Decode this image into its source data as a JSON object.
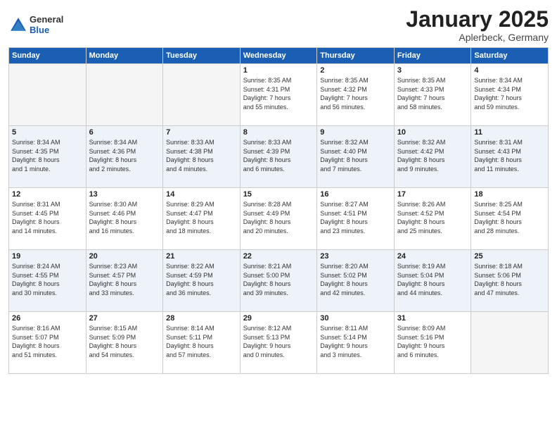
{
  "logo": {
    "general": "General",
    "blue": "Blue"
  },
  "title": "January 2025",
  "location": "Aplerbeck, Germany",
  "days_header": [
    "Sunday",
    "Monday",
    "Tuesday",
    "Wednesday",
    "Thursday",
    "Friday",
    "Saturday"
  ],
  "weeks": [
    {
      "row_class": "row-odd",
      "days": [
        {
          "num": "",
          "info": "",
          "empty": true
        },
        {
          "num": "",
          "info": "",
          "empty": true
        },
        {
          "num": "",
          "info": "",
          "empty": true
        },
        {
          "num": "1",
          "info": "Sunrise: 8:35 AM\nSunset: 4:31 PM\nDaylight: 7 hours\nand 55 minutes.",
          "empty": false
        },
        {
          "num": "2",
          "info": "Sunrise: 8:35 AM\nSunset: 4:32 PM\nDaylight: 7 hours\nand 56 minutes.",
          "empty": false
        },
        {
          "num": "3",
          "info": "Sunrise: 8:35 AM\nSunset: 4:33 PM\nDaylight: 7 hours\nand 58 minutes.",
          "empty": false
        },
        {
          "num": "4",
          "info": "Sunrise: 8:34 AM\nSunset: 4:34 PM\nDaylight: 7 hours\nand 59 minutes.",
          "empty": false
        }
      ]
    },
    {
      "row_class": "row-even",
      "days": [
        {
          "num": "5",
          "info": "Sunrise: 8:34 AM\nSunset: 4:35 PM\nDaylight: 8 hours\nand 1 minute.",
          "empty": false
        },
        {
          "num": "6",
          "info": "Sunrise: 8:34 AM\nSunset: 4:36 PM\nDaylight: 8 hours\nand 2 minutes.",
          "empty": false
        },
        {
          "num": "7",
          "info": "Sunrise: 8:33 AM\nSunset: 4:38 PM\nDaylight: 8 hours\nand 4 minutes.",
          "empty": false
        },
        {
          "num": "8",
          "info": "Sunrise: 8:33 AM\nSunset: 4:39 PM\nDaylight: 8 hours\nand 6 minutes.",
          "empty": false
        },
        {
          "num": "9",
          "info": "Sunrise: 8:32 AM\nSunset: 4:40 PM\nDaylight: 8 hours\nand 7 minutes.",
          "empty": false
        },
        {
          "num": "10",
          "info": "Sunrise: 8:32 AM\nSunset: 4:42 PM\nDaylight: 8 hours\nand 9 minutes.",
          "empty": false
        },
        {
          "num": "11",
          "info": "Sunrise: 8:31 AM\nSunset: 4:43 PM\nDaylight: 8 hours\nand 11 minutes.",
          "empty": false
        }
      ]
    },
    {
      "row_class": "row-odd",
      "days": [
        {
          "num": "12",
          "info": "Sunrise: 8:31 AM\nSunset: 4:45 PM\nDaylight: 8 hours\nand 14 minutes.",
          "empty": false
        },
        {
          "num": "13",
          "info": "Sunrise: 8:30 AM\nSunset: 4:46 PM\nDaylight: 8 hours\nand 16 minutes.",
          "empty": false
        },
        {
          "num": "14",
          "info": "Sunrise: 8:29 AM\nSunset: 4:47 PM\nDaylight: 8 hours\nand 18 minutes.",
          "empty": false
        },
        {
          "num": "15",
          "info": "Sunrise: 8:28 AM\nSunset: 4:49 PM\nDaylight: 8 hours\nand 20 minutes.",
          "empty": false
        },
        {
          "num": "16",
          "info": "Sunrise: 8:27 AM\nSunset: 4:51 PM\nDaylight: 8 hours\nand 23 minutes.",
          "empty": false
        },
        {
          "num": "17",
          "info": "Sunrise: 8:26 AM\nSunset: 4:52 PM\nDaylight: 8 hours\nand 25 minutes.",
          "empty": false
        },
        {
          "num": "18",
          "info": "Sunrise: 8:25 AM\nSunset: 4:54 PM\nDaylight: 8 hours\nand 28 minutes.",
          "empty": false
        }
      ]
    },
    {
      "row_class": "row-even",
      "days": [
        {
          "num": "19",
          "info": "Sunrise: 8:24 AM\nSunset: 4:55 PM\nDaylight: 8 hours\nand 30 minutes.",
          "empty": false
        },
        {
          "num": "20",
          "info": "Sunrise: 8:23 AM\nSunset: 4:57 PM\nDaylight: 8 hours\nand 33 minutes.",
          "empty": false
        },
        {
          "num": "21",
          "info": "Sunrise: 8:22 AM\nSunset: 4:59 PM\nDaylight: 8 hours\nand 36 minutes.",
          "empty": false
        },
        {
          "num": "22",
          "info": "Sunrise: 8:21 AM\nSunset: 5:00 PM\nDaylight: 8 hours\nand 39 minutes.",
          "empty": false
        },
        {
          "num": "23",
          "info": "Sunrise: 8:20 AM\nSunset: 5:02 PM\nDaylight: 8 hours\nand 42 minutes.",
          "empty": false
        },
        {
          "num": "24",
          "info": "Sunrise: 8:19 AM\nSunset: 5:04 PM\nDaylight: 8 hours\nand 44 minutes.",
          "empty": false
        },
        {
          "num": "25",
          "info": "Sunrise: 8:18 AM\nSunset: 5:06 PM\nDaylight: 8 hours\nand 47 minutes.",
          "empty": false
        }
      ]
    },
    {
      "row_class": "row-odd",
      "days": [
        {
          "num": "26",
          "info": "Sunrise: 8:16 AM\nSunset: 5:07 PM\nDaylight: 8 hours\nand 51 minutes.",
          "empty": false
        },
        {
          "num": "27",
          "info": "Sunrise: 8:15 AM\nSunset: 5:09 PM\nDaylight: 8 hours\nand 54 minutes.",
          "empty": false
        },
        {
          "num": "28",
          "info": "Sunrise: 8:14 AM\nSunset: 5:11 PM\nDaylight: 8 hours\nand 57 minutes.",
          "empty": false
        },
        {
          "num": "29",
          "info": "Sunrise: 8:12 AM\nSunset: 5:13 PM\nDaylight: 9 hours\nand 0 minutes.",
          "empty": false
        },
        {
          "num": "30",
          "info": "Sunrise: 8:11 AM\nSunset: 5:14 PM\nDaylight: 9 hours\nand 3 minutes.",
          "empty": false
        },
        {
          "num": "31",
          "info": "Sunrise: 8:09 AM\nSunset: 5:16 PM\nDaylight: 9 hours\nand 6 minutes.",
          "empty": false
        },
        {
          "num": "",
          "info": "",
          "empty": true
        }
      ]
    }
  ]
}
